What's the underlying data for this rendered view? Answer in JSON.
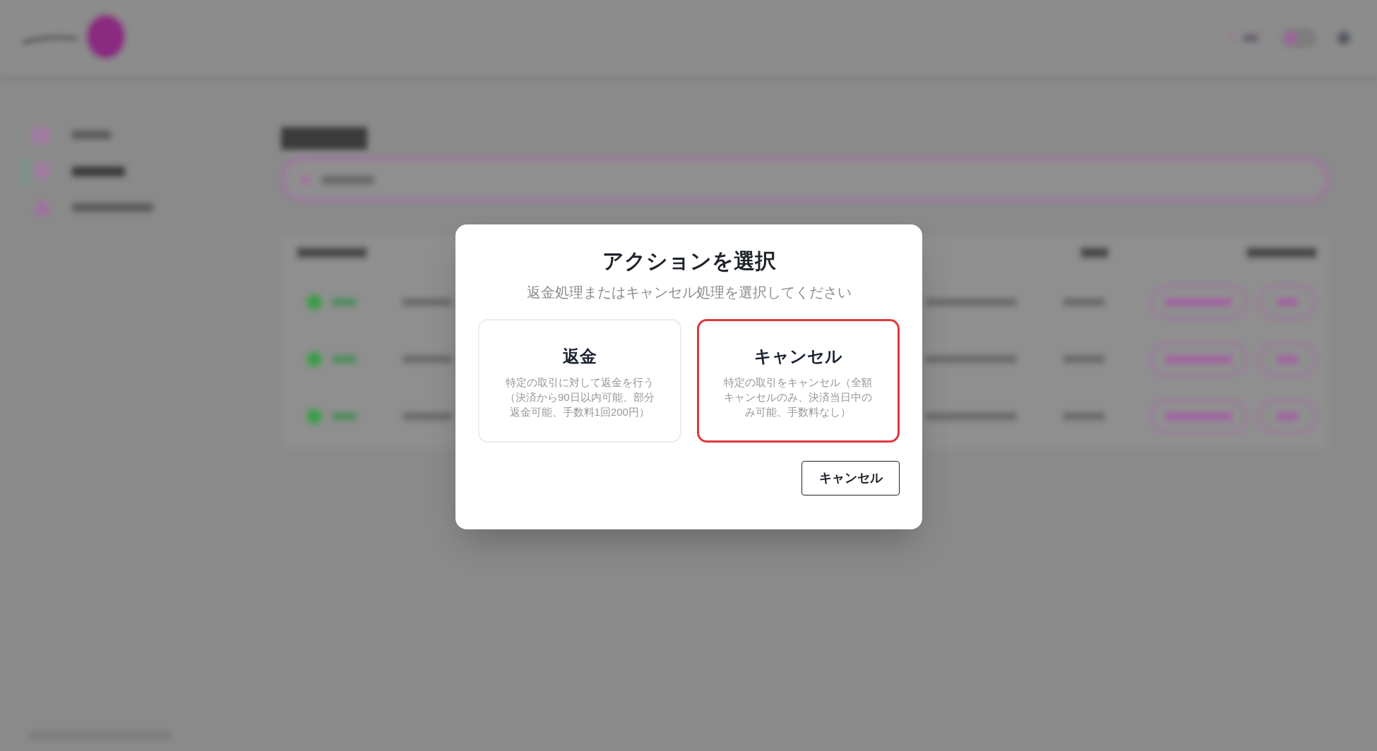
{
  "dialog": {
    "title": "アクションを選択",
    "subtitle": "返金処理またはキャンセル処理を選択してください",
    "options": [
      {
        "title": "返金",
        "description": "特定の取引に対して返金を行う（決済から90日以内可能、部分返金可能、手数料1回200円）",
        "selected": false
      },
      {
        "title": "キャンセル",
        "description": "特定の取引をキャンセル（全額キャンセルのみ、決済当日中のみ可能、手数料なし）",
        "selected": true
      }
    ],
    "button": "キャンセル"
  }
}
